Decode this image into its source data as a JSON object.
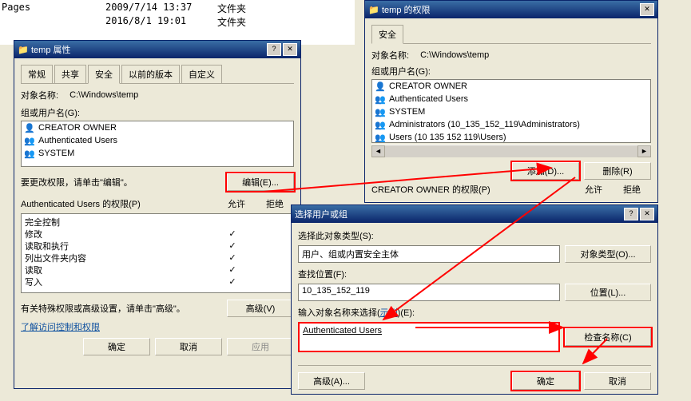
{
  "bg_files": [
    {
      "name": "Pages",
      "date": "2009/7/14 13:37",
      "type": "文件夹"
    },
    {
      "name": "",
      "date": "2016/8/1 19:01",
      "type": "文件夹"
    }
  ],
  "win1": {
    "title": "temp 属性",
    "tabs": [
      "常规",
      "共享",
      "安全",
      "以前的版本",
      "自定义"
    ],
    "active_tab": 2,
    "object_label": "对象名称:",
    "object_path": "C:\\Windows\\temp",
    "groups_label": "组或用户名(G):",
    "groups": [
      "CREATOR OWNER",
      "Authenticated Users",
      "SYSTEM"
    ],
    "edit_hint": "要更改权限，请单击\"编辑\"。",
    "edit_btn": "编辑(E)...",
    "perms_label": "Authenticated Users 的权限(P)",
    "allow": "允许",
    "deny": "拒绝",
    "perms": [
      {
        "name": "完全控制",
        "allow": false,
        "deny": false
      },
      {
        "name": "修改",
        "allow": true,
        "deny": false
      },
      {
        "name": "读取和执行",
        "allow": true,
        "deny": false
      },
      {
        "name": "列出文件夹内容",
        "allow": true,
        "deny": false
      },
      {
        "name": "读取",
        "allow": true,
        "deny": false
      },
      {
        "name": "写入",
        "allow": true,
        "deny": false
      }
    ],
    "adv_hint": "有关特殊权限或高级设置，请单击\"高级\"。",
    "adv_btn": "高级(V)",
    "help_link": "了解访问控制和权限",
    "ok": "确定",
    "cancel": "取消",
    "apply": "应用"
  },
  "win2": {
    "title": "temp 的权限",
    "tab": "安全",
    "object_label": "对象名称:",
    "object_path": "C:\\Windows\\temp",
    "groups_label": "组或用户名(G):",
    "groups": [
      "CREATOR OWNER",
      "Authenticated Users",
      "SYSTEM",
      "Administrators (10_135_152_119\\Administrators)",
      "Users (10 135 152 119\\Users)"
    ],
    "add_btn": "添加(D)...",
    "remove_btn": "删除(R)",
    "owner_perms_label": "CREATOR OWNER 的权限(P)",
    "allow": "允许",
    "deny": "拒绝"
  },
  "win3": {
    "title": "选择用户或组",
    "obj_type_label": "选择此对象类型(S):",
    "obj_type_value": "用户、组或内置安全主体",
    "obj_type_btn": "对象类型(O)...",
    "loc_label": "查找位置(F):",
    "loc_value": "10_135_152_119",
    "loc_btn": "位置(L)...",
    "names_label": "输入对象名称来选择(",
    "example": "示例",
    "names_label2": ")(E):",
    "names_value": "Authenticated Users",
    "check_btn": "检查名称(C)",
    "adv_btn": "高级(A)...",
    "ok": "确定",
    "cancel": "取消"
  }
}
